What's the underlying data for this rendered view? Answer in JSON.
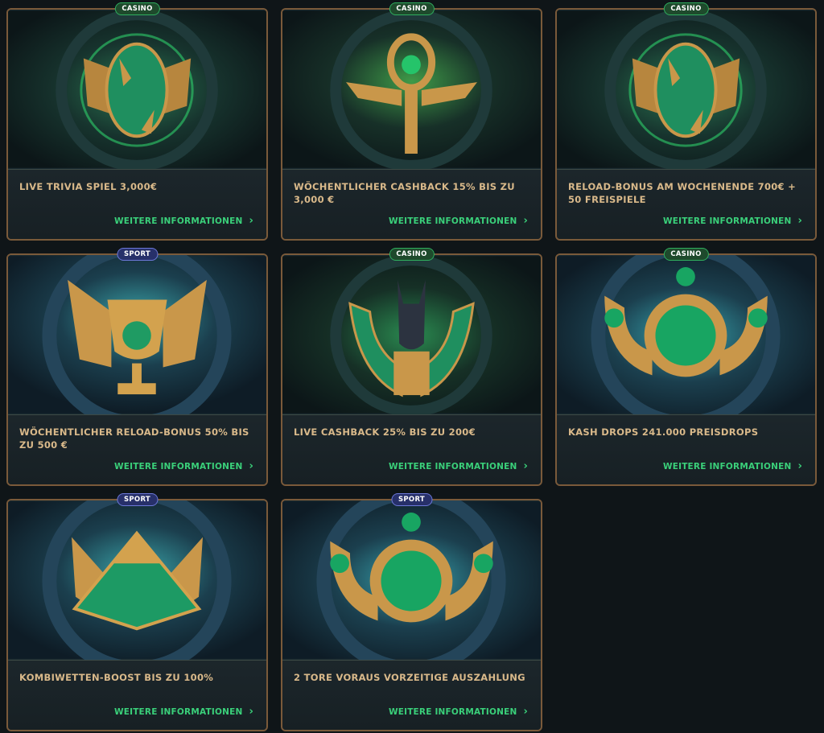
{
  "colors": {
    "page_bg": "#0f1518",
    "card_border": "#7a5a3a",
    "title_text": "#d9b98a",
    "link_text": "#3ad07a",
    "casino_badge": "#1e4a2c",
    "sport_badge": "#27306a"
  },
  "cards": [
    {
      "badge": "CASINO",
      "badge_type": "casino",
      "art": "crocodile-emblem-icon",
      "title": "LIVE TRIVIA SPIEL 3,000€",
      "link": "WEITERE INFORMATIONEN"
    },
    {
      "badge": "CASINO",
      "badge_type": "casino",
      "art": "ankh-emblem-icon",
      "title": "WÖCHENTLICHER CASHBACK 15% BIS ZU 3,000 €",
      "link": "WEITERE INFORMATIONEN"
    },
    {
      "badge": "CASINO",
      "badge_type": "casino",
      "art": "crocodile-emblem-icon",
      "title": "RELOAD-BONUS AM WOCHENENDE 700€ + 50 FREISPIELE",
      "link": "WEITERE INFORMATIONEN"
    },
    {
      "badge": "SPORT",
      "badge_type": "sport",
      "art": "winged-cup-icon",
      "title": "WÖCHENTLICHER RELOAD-BONUS 50% BIS ZU 500 €",
      "link": "WEITERE INFORMATIONEN"
    },
    {
      "badge": "CASINO",
      "badge_type": "casino",
      "art": "anubis-emblem-icon",
      "title": "LIVE CASHBACK 25% BIS ZU 200€",
      "link": "WEITERE INFORMATIONEN"
    },
    {
      "badge": "CASINO",
      "badge_type": "casino",
      "art": "eye-of-horus-emblem-icon",
      "title": "KASH DROPS 241.000 PREISDROPS",
      "link": "WEITERE INFORMATIONEN"
    },
    {
      "badge": "SPORT",
      "badge_type": "sport",
      "art": "pyramid-emblem-icon",
      "title": "KOMBIWETTEN-BOOST BIS ZU 100%",
      "link": "WEITERE INFORMATIONEN"
    },
    {
      "badge": "SPORT",
      "badge_type": "sport",
      "art": "eye-of-horus-emblem-icon",
      "title": "2 TORE VORAUS VORZEITIGE AUSZAHLUNG",
      "link": "WEITERE INFORMATIONEN"
    }
  ]
}
